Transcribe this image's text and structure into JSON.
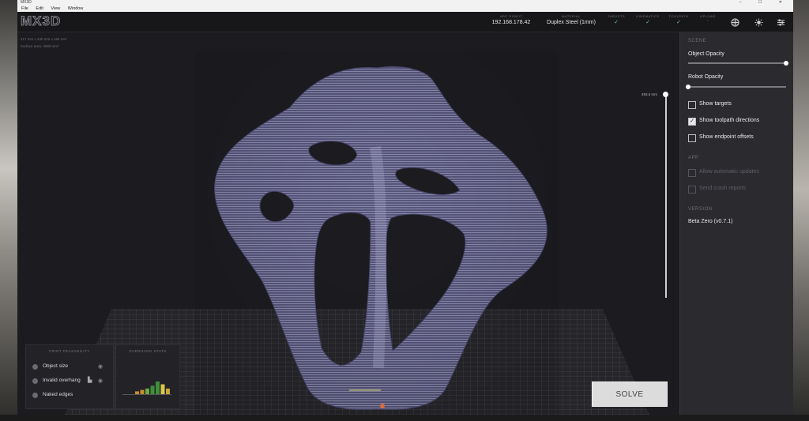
{
  "window": {
    "title": "MX3D",
    "controls": "– ☐ ✕"
  },
  "menu": [
    "File",
    "Edit",
    "View",
    "Window"
  ],
  "header": {
    "logo": "MX3D",
    "ip_label": "ARC ROBOT",
    "ip_value": "192.168.178.42",
    "material_label": "MATERIAL",
    "material_value": "Duplex Steel (1mm)",
    "targets_label": "TARGETS",
    "kinematics_label": "KINEMATICS",
    "toolpath_label": "TOOLPATH",
    "upload_label": "UPLOAD",
    "check_mark": "✓",
    "dash_mark": "-",
    "icons": [
      "globe-icon",
      "sun-icon",
      "sliders-icon"
    ]
  },
  "viewport": {
    "dimensions": "417 mm x 430 mm x 494 mm",
    "surface_area": "Surface area: 4080 mm²",
    "height_label": "493.5 mm",
    "height_fraction": 1.0
  },
  "feasibility": {
    "title": "PRINT FEASABILITY",
    "items": [
      {
        "label": "Object size",
        "icon": "eye-icon"
      },
      {
        "label": "Invalid overhang",
        "icon": "eye-icon"
      },
      {
        "label": "Naked edges",
        "icon": ""
      }
    ]
  },
  "overhang": {
    "title": "OVERHANG STATS",
    "bars": [
      2,
      3,
      4,
      6,
      9,
      7,
      4
    ],
    "colors": [
      "#c98f2a",
      "#c98f2a",
      "#6ea84a",
      "#3f8f3a",
      "#3f8f3a",
      "#d8c84a",
      "#c9a63a"
    ]
  },
  "solve_label": "SOLVE",
  "sidebar": {
    "scene_title": "SCENE",
    "object_opacity_label": "Object Opacity",
    "object_opacity": 1.0,
    "robot_opacity_label": "Robot Opacity",
    "robot_opacity": 0.0,
    "options": [
      {
        "label": "Show targets",
        "checked": false
      },
      {
        "label": "Show toolpath directions",
        "checked": true
      },
      {
        "label": "Show endpoint offsets",
        "checked": false
      }
    ],
    "app_title": "APP",
    "app_options": [
      {
        "label": "Allow automatic updates",
        "checked": false
      },
      {
        "label": "Send crash reports",
        "checked": false
      }
    ],
    "version_title": "VERSION",
    "version_value": "Beta Zero (v0.7.1)"
  }
}
